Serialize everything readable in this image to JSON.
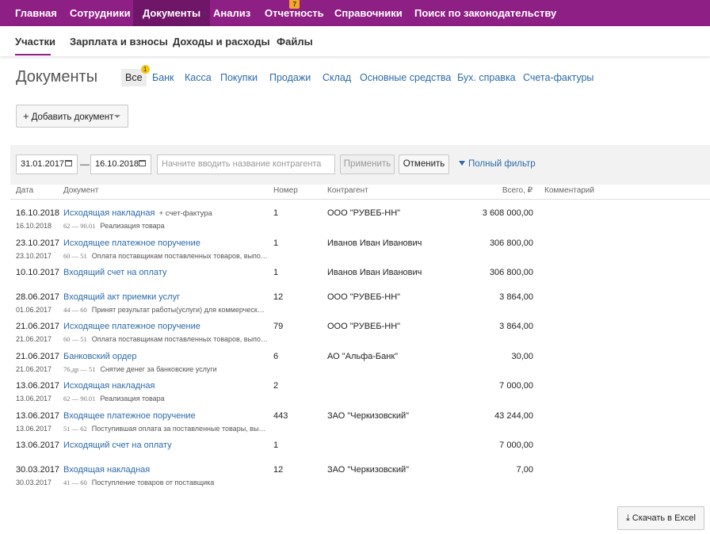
{
  "top_nav": [
    {
      "label": "Главная"
    },
    {
      "label": "Сотрудники"
    },
    {
      "label": "Документы"
    },
    {
      "label": "Анализ"
    },
    {
      "label": "Отчетность",
      "badge": "7"
    },
    {
      "label": "Справочники"
    },
    {
      "label": "Поиск по законодательству"
    }
  ],
  "sub_nav": [
    "Участки",
    "Зарплата и взносы",
    "Доходы и расходы",
    "Файлы"
  ],
  "page": {
    "title": "Документы",
    "tabs": [
      "Все",
      "Банк",
      "Касса",
      "Покупки",
      "Продажи",
      "Склад",
      "Основные средства",
      "Бух. справка",
      "Счета-фактуры"
    ],
    "all_badge": "1",
    "add_button": "Добавить документ"
  },
  "filter": {
    "date_from": "31.01.2017",
    "date_to": "16.10.2018",
    "search_placeholder": "Начните вводить название контрагента",
    "apply": "Применить",
    "cancel": "Отменить",
    "full_filter": "Полный фильтр",
    "dash": "—"
  },
  "columns": [
    "Дата",
    "Документ",
    "Номер",
    "Контрагент",
    "Всего, ₽",
    "Комментарий"
  ],
  "rows": [
    {
      "date": "16.10.2018",
      "date2": "16.10.2018",
      "doc": "Исходящая накладная",
      "extra": "+ счет-фактура",
      "acc": "62 — 90.01",
      "desc": "Реализация товара",
      "num": "1",
      "partner": "ООО \"РУВЕБ-НН\"",
      "total": "3 608 000,00"
    },
    {
      "date": "23.10.2017",
      "date2": "23.10.2017",
      "doc": "Исходящее платежное поручение",
      "extra": "",
      "acc": "60 — 51",
      "desc": "Оплата поставщикам поставленных товаров, выполненных работ, оказанных услуг",
      "num": "1",
      "partner": "Иванов Иван Иванович",
      "total": "306 800,00"
    },
    {
      "date": "10.10.2017",
      "date2": "",
      "doc": "Входящий счет на оплату",
      "extra": "",
      "acc": "",
      "desc": "",
      "num": "1",
      "partner": "Иванов Иван Иванович",
      "total": "306 800,00"
    },
    {
      "date": "28.06.2017",
      "date2": "01.06.2017",
      "doc": "Входящий акт приемки услуг",
      "extra": "",
      "acc": "44 — 60",
      "desc": "Принят результат работы(услуги) для коммерческих целей",
      "num": "12",
      "partner": "ООО \"РУВЕБ-НН\"",
      "total": "3 864,00"
    },
    {
      "date": "21.06.2017",
      "date2": "21.06.2017",
      "doc": "Исходящее платежное поручение",
      "extra": "",
      "acc": "60 — 51",
      "desc": "Оплата поставщикам поставленных товаров, выполненных работ, оказанных услуг",
      "num": "79",
      "partner": "ООО \"РУВЕБ-НН\"",
      "total": "3 864,00"
    },
    {
      "date": "21.06.2017",
      "date2": "21.06.2017",
      "doc": "Банковский ордер",
      "extra": "",
      "acc": "76.др — 51",
      "desc": "Снятие денег за банковские услуги",
      "num": "6",
      "partner": "АО \"Альфа-Банк\"",
      "total": "30,00"
    },
    {
      "date": "13.06.2017",
      "date2": "13.06.2017",
      "doc": "Исходящая накладная",
      "extra": "",
      "acc": "62 — 90.01",
      "desc": "Реализация товара",
      "num": "2",
      "partner": "",
      "total": "7 000,00"
    },
    {
      "date": "13.06.2017",
      "date2": "13.06.2017",
      "doc": "Входящее платежное поручение",
      "extra": "",
      "acc": "51 — 62",
      "desc": "Поступившая оплата за поставленные товары, выполненные работы",
      "num": "443",
      "partner": "ЗАО \"Черкизовский\"",
      "total": "43 244,00"
    },
    {
      "date": "13.06.2017",
      "date2": "",
      "doc": "Исходящий счет на оплату",
      "extra": "",
      "acc": "",
      "desc": "",
      "num": "1",
      "partner": "",
      "total": "7 000,00"
    },
    {
      "date": "30.03.2017",
      "date2": "30.03.2017",
      "doc": "Входящая накладная",
      "extra": "",
      "acc": "41 — 60",
      "desc": "Поступление товаров от поставщика",
      "num": "12",
      "partner": "ЗАО \"Черкизовский\"",
      "total": "7,00"
    }
  ],
  "excel_button": "Скачать в Excel"
}
